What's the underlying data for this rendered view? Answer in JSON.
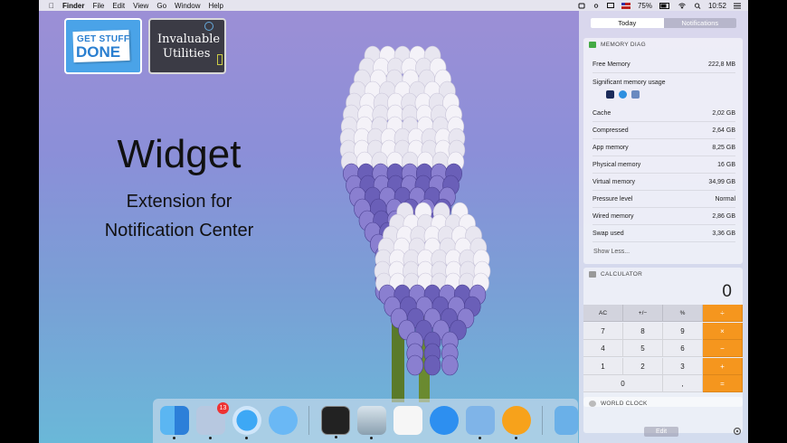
{
  "menubar": {
    "app": "Finder",
    "items": [
      "File",
      "Edit",
      "View",
      "Go",
      "Window",
      "Help"
    ],
    "battery": "75%",
    "time": "10:52"
  },
  "apps": {
    "gsd_line1": "GET STUFF",
    "gsd_line2": "DONE",
    "iu_line1": "Invaluable",
    "iu_line2": "Utilities"
  },
  "promo": {
    "title": "Widget",
    "subtitle1": "Extension for",
    "subtitle2": "Notification Center"
  },
  "dock": {
    "mail_badge": "13"
  },
  "notification_center": {
    "tab_today": "Today",
    "tab_notifications": "Notifications",
    "memory": {
      "title": "MEMORY DIAG",
      "free_label": "Free Memory",
      "free_value": "222,8 MB",
      "significant_label": "Significant memory usage",
      "rows": [
        {
          "label": "Cache",
          "value": "2,02 GB"
        },
        {
          "label": "Compressed",
          "value": "2,64 GB"
        },
        {
          "label": "App memory",
          "value": "8,25 GB"
        },
        {
          "label": "Physical memory",
          "value": "16 GB"
        },
        {
          "label": "Virtual memory",
          "value": "34,99 GB"
        },
        {
          "label": "Pressure level",
          "value": "Normal"
        },
        {
          "label": "Wired memory",
          "value": "2,86 GB"
        },
        {
          "label": "Swap used",
          "value": "3,36 GB"
        }
      ],
      "show_less": "Show Less..."
    },
    "calculator": {
      "title": "CALCULATOR",
      "display": "0",
      "keys": [
        "AC",
        "+/−",
        "%",
        "÷",
        "7",
        "8",
        "9",
        "×",
        "4",
        "5",
        "6",
        "−",
        "1",
        "2",
        "3",
        "+",
        "0",
        ",",
        "="
      ]
    },
    "world_clock": {
      "title": "WORLD CLOCK"
    },
    "edit_label": "Edit"
  },
  "colors": {
    "calc_operator": "#f5961e",
    "accent_blue": "#2a7fd0"
  }
}
